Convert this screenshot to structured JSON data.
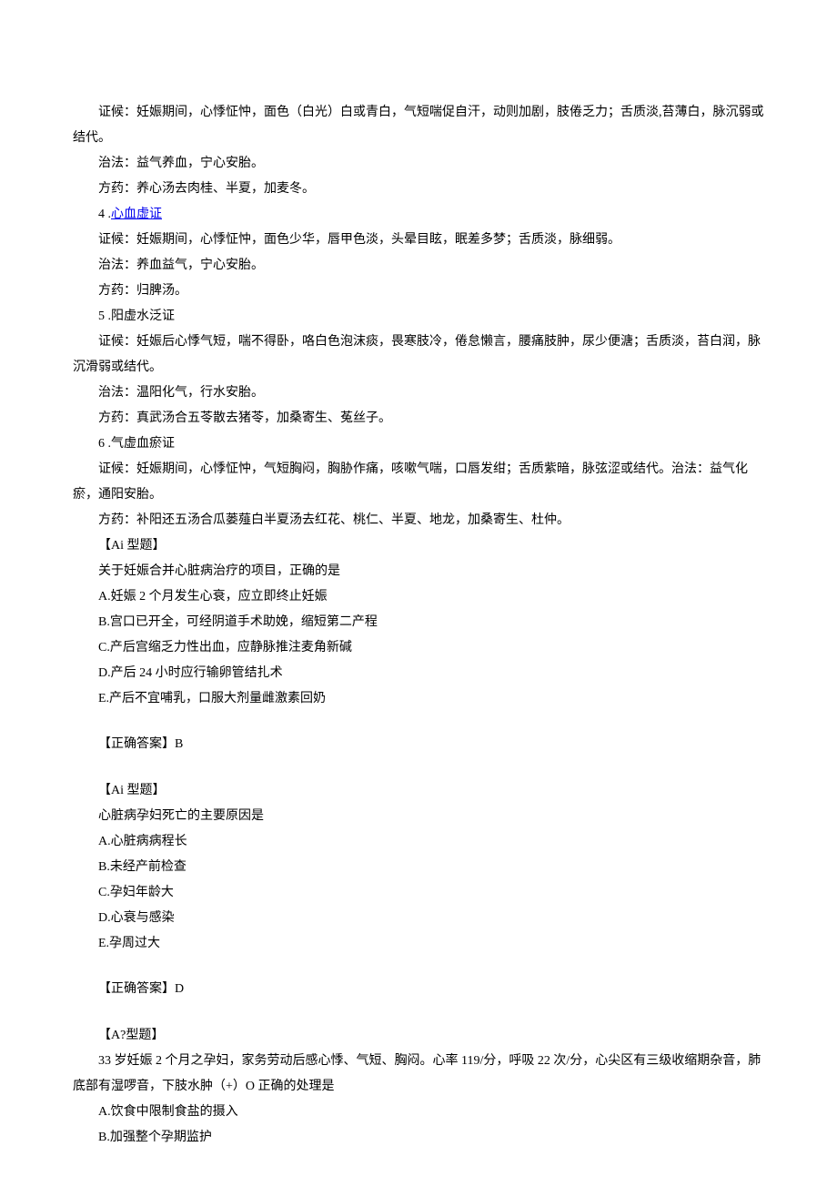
{
  "lines": {
    "l01": "证候：妊娠期间，心悸怔忡，面色（白光）白或青白，气短喘促自汗，动则加剧，肢倦乏力；舌质淡,苔薄白，脉沉弱或结代。",
    "l02": "治法：益气养血，宁心安胎。",
    "l03": "方药：养心汤去肉桂、半夏，加麦冬。",
    "l04_num": "4 .",
    "l04_link": "心血虚证",
    "l05": "证候：妊娠期间，心悸怔忡，面色少华，唇甲色淡，头晕目眩，眠差多梦；舌质淡，脉细弱。",
    "l06": "治法：养血益气，宁心安胎。",
    "l07": "方药：归脾汤。",
    "l08": "5 .阳虚水泛证",
    "l09": "证候：妊娠后心悸气短，喘不得卧，咯白色泡沫痰，畏寒肢冷，倦怠懒言，腰痛肢肿，尿少便溏；舌质淡，苔白润，脉沉滑弱或结代。",
    "l10": "治法：温阳化气，行水安胎。",
    "l11": "方药：真武汤合五苓散去猪苓，加桑寄生、菟丝子。",
    "l12": "6 .气虚血瘀证",
    "l13": "证候：妊娠期间，心悸怔忡，气短胸闷，胸胁作痛，咳嗽气喘，口唇发绀；舌质紫暗，脉弦涩或结代。治法：益气化瘀，通阳安胎。",
    "l14": "方药：补阳还五汤合瓜蒌薤白半夏汤去红花、桃仁、半夏、地龙，加桑寄生、杜仲。",
    "l15": "【Ai 型题】",
    "l16": "关于妊娠合并心脏病治疗的项目，正确的是",
    "l17": "A.妊娠 2 个月发生心衰，应立即终止妊娠",
    "l18": "B.宫口已开全，可经阴道手术助娩，缩短第二产程",
    "l19": "C.产后宫缩乏力性出血，应静脉推注麦角新碱",
    "l20": "D.产后 24 小时应行输卵管结扎术",
    "l21": "E.产后不宜哺乳，口服大剂量雌激素回奶",
    "l22": "【正确答案】B",
    "l23": "【Ai 型题】",
    "l24": "心脏病孕妇死亡的主要原因是",
    "l25": "A.心脏病病程长",
    "l26": "B.未经产前检查",
    "l27": "C.孕妇年龄大",
    "l28": "D.心衰与感染",
    "l29": "E.孕周过大",
    "l30": "【正确答案】D",
    "l31": "【A?型题】",
    "l32": "33 岁妊娠 2 个月之孕妇，家务劳动后感心悸、气短、胸闷。心率 119/分，呼吸 22 次/分，心尖区有三级收缩期杂音，肺底部有湿啰音，下肢水肿（+）O 正确的处理是",
    "l33": "A.饮食中限制食盐的摄入",
    "l34": "B.加强整个孕期监护"
  }
}
